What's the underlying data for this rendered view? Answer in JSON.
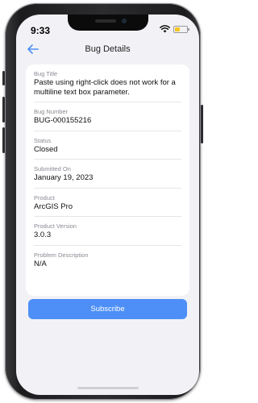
{
  "status_bar": {
    "time": "9:33"
  },
  "nav": {
    "title": "Bug Details"
  },
  "fields": [
    {
      "label": "Bug Title",
      "value": "Paste using right-click does not work for a multiline text box parameter."
    },
    {
      "label": "Bug Number",
      "value": "BUG-000155216"
    },
    {
      "label": "Status",
      "value": "Closed"
    },
    {
      "label": "Submitted On",
      "value": "January 19, 2023"
    },
    {
      "label": "Product",
      "value": "ArcGIS Pro"
    },
    {
      "label": "Product Version",
      "value": "3.0.3"
    },
    {
      "label": "Problem Description",
      "value": "N/A"
    }
  ],
  "subscribe_label": "Subscribe",
  "colors": {
    "accent": "#4d8ff6",
    "background": "#f2f2f6",
    "card": "#ffffff"
  },
  "icons": {
    "back": "arrow-left-icon",
    "wifi": "wifi-icon",
    "battery": "battery-icon"
  }
}
